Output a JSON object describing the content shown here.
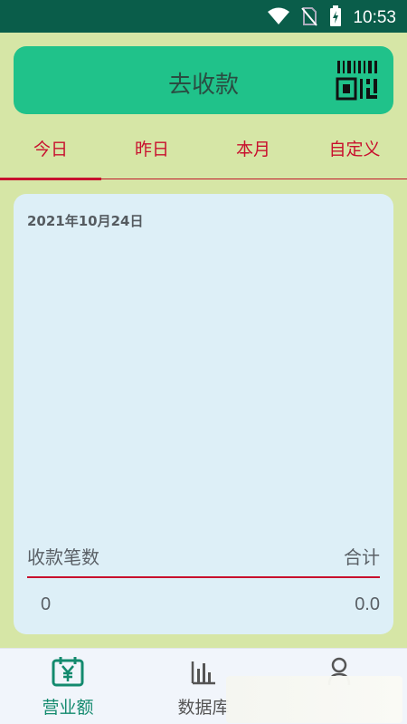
{
  "status_bar": {
    "time": "10:53",
    "icons": [
      "wifi-icon",
      "no-sim-icon",
      "battery-charging-icon"
    ]
  },
  "collect_button": {
    "label": "去收款",
    "icon": "qr-scan-icon"
  },
  "tabs": [
    {
      "label": "今日",
      "active": true
    },
    {
      "label": "昨日",
      "active": false
    },
    {
      "label": "本月",
      "active": false
    },
    {
      "label": "自定义",
      "active": false
    }
  ],
  "summary": {
    "date": "2021年10月24日",
    "count_label": "收款笔数",
    "total_label": "合计",
    "count_value": "0",
    "total_value": "0.0"
  },
  "bottom_nav": [
    {
      "label": "营业额",
      "icon": "calendar-yuan-icon",
      "active": true
    },
    {
      "label": "数据库",
      "icon": "bar-chart-icon",
      "active": false
    },
    {
      "label": "",
      "icon": "user-icon",
      "active": false
    }
  ],
  "colors": {
    "accent": "#c8102e",
    "button": "#20c28a",
    "status_bar": "#0a5d4a",
    "background": "#d6e6a6",
    "card": "#ddeff7",
    "nav_active": "#138a6e"
  }
}
